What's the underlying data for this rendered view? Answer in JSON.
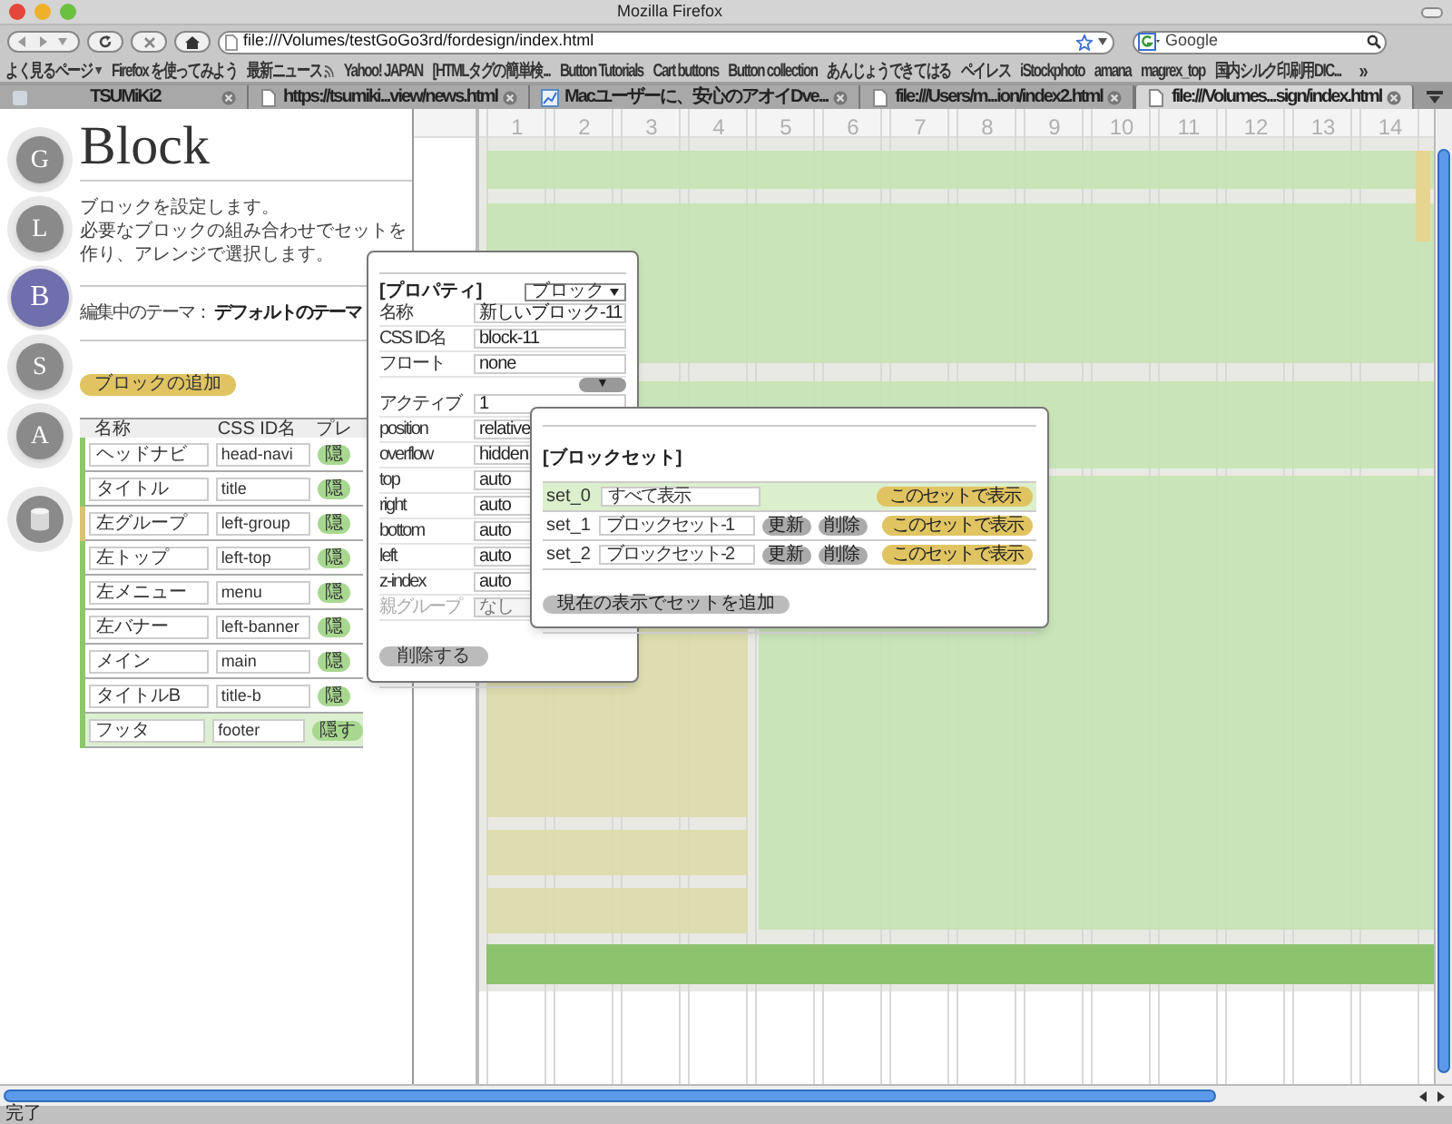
{
  "window": {
    "title": "Mozilla Firefox"
  },
  "toolbar": {
    "url": "file:///Volumes/testGoGo3rd/fordesign/index.html",
    "search_placeholder": "Google"
  },
  "bookmarks": [
    {
      "label": "よく見るページ",
      "kind": "menu"
    },
    {
      "label": "Firefox を使ってみよう",
      "kind": "link"
    },
    {
      "label": "最新ニュース",
      "kind": "feed"
    },
    {
      "label": "Yahoo! JAPAN",
      "kind": "link"
    },
    {
      "label": "[HTMLタグの簡単検...",
      "kind": "link"
    },
    {
      "label": "Button Tutorials",
      "kind": "link"
    },
    {
      "label": "Cart buttons",
      "kind": "link"
    },
    {
      "label": "Button collection",
      "kind": "link"
    },
    {
      "label": "あんじょうできてはる",
      "kind": "link"
    },
    {
      "label": "ペイレス",
      "kind": "link"
    },
    {
      "label": "iStockphoto",
      "kind": "link"
    },
    {
      "label": "amana",
      "kind": "link"
    },
    {
      "label": "magrex_top",
      "kind": "link"
    },
    {
      "label": "国内シルク印刷用DIC...",
      "kind": "link"
    },
    {
      "label": "»",
      "kind": "more"
    }
  ],
  "tabs": [
    {
      "label": "TSUMiKi2",
      "selected": false
    },
    {
      "label": "https://tsumiki...view/news.html",
      "selected": false
    },
    {
      "label": "Macユーザーに、安心のアオイDve...",
      "selected": false
    },
    {
      "label": "file:///Users/m...ion/index2.html",
      "selected": false
    },
    {
      "label": "file:///Volumes...sign/index.html",
      "selected": true
    }
  ],
  "nav": [
    {
      "label": "G",
      "selected": false
    },
    {
      "label": "L",
      "selected": false
    },
    {
      "label": "B",
      "selected": true
    },
    {
      "label": "S",
      "selected": false
    },
    {
      "label": "A",
      "selected": false
    }
  ],
  "page": {
    "heading": "Block",
    "description": [
      "ブロックを設定します。",
      "必要なブロックの組み合わせでセットを作り、アレンジで選択します。"
    ],
    "theme_label": "編集中のテーマ：",
    "theme_value": "デフォルトのテーマ",
    "add_button": "ブロックの追加"
  },
  "block_table": {
    "columns": [
      "名称",
      "CSS ID名",
      "プレ"
    ],
    "rows": [
      {
        "name": "ヘッドナビ",
        "css_id": "head-navi",
        "button": "隠",
        "color": "#8cc86a",
        "selected": false
      },
      {
        "name": "タイトル",
        "css_id": "title",
        "button": "隠",
        "color": "#8cc86a",
        "selected": false
      },
      {
        "name": "左グループ",
        "css_id": "left-group",
        "button": "隠",
        "color": "#d9c274",
        "selected": false
      },
      {
        "name": "左トップ",
        "css_id": "left-top",
        "button": "隠",
        "color": "#8cc86a",
        "selected": false
      },
      {
        "name": "左メニュー",
        "css_id": "menu",
        "button": "隠",
        "color": "#8cc86a",
        "selected": false
      },
      {
        "name": "左バナー",
        "css_id": "left-banner",
        "button": "隠",
        "color": "#8cc86a",
        "selected": false
      },
      {
        "name": "メイン",
        "css_id": "main",
        "button": "隠",
        "color": "#8cc86a",
        "selected": false
      },
      {
        "name": "タイトルB",
        "css_id": "title-b",
        "button": "隠",
        "color": "#8cc86a",
        "selected": false
      },
      {
        "name": "フッタ",
        "css_id": "footer",
        "button": "隠す",
        "color": "#8cc86a",
        "selected": true
      }
    ]
  },
  "properties": {
    "title": "[プロパティ]",
    "type": "ブロック",
    "toggle": "▼",
    "fields": [
      {
        "label": "名称",
        "value": "新しいブロック-11"
      },
      {
        "label": "CSS ID名",
        "value": "block-11"
      },
      {
        "label": "フロート",
        "value": "none"
      }
    ],
    "style_fields": [
      {
        "label": "アクティブ",
        "value": "1",
        "disabled": false
      },
      {
        "label": "position",
        "value": "relative",
        "disabled": false
      },
      {
        "label": "overflow",
        "value": "hidden",
        "disabled": false
      },
      {
        "label": "top",
        "value": "auto",
        "disabled": false
      },
      {
        "label": "right",
        "value": "auto",
        "disabled": false
      },
      {
        "label": "bottom",
        "value": "auto",
        "disabled": false
      },
      {
        "label": "left",
        "value": "auto",
        "disabled": false
      },
      {
        "label": "z-index",
        "value": "auto",
        "disabled": false
      },
      {
        "label": "親グループ",
        "value": "なし",
        "disabled": true
      }
    ],
    "delete_button": "削除する"
  },
  "block_sets": {
    "title": "[ブロックセット]",
    "sets": [
      {
        "name": "set_0",
        "value": "すべて表示",
        "show_button": "このセットで表示",
        "selected": true
      },
      {
        "name": "set_1",
        "value": "ブロックセット-1",
        "update_button": "更新",
        "delete_button": "削除",
        "show_button": "このセットで表示",
        "selected": false
      },
      {
        "name": "set_2",
        "value": "ブロックセット-2",
        "update_button": "更新",
        "delete_button": "削除",
        "show_button": "このセットで表示",
        "selected": false
      }
    ],
    "add_button": "現在の表示でセットを追加"
  },
  "canvas": {
    "columns": [
      "1",
      "2",
      "3",
      "4",
      "5",
      "6",
      "7",
      "8",
      "9",
      "10",
      "11",
      "12",
      "13",
      "14"
    ]
  },
  "status_bar": "完了"
}
